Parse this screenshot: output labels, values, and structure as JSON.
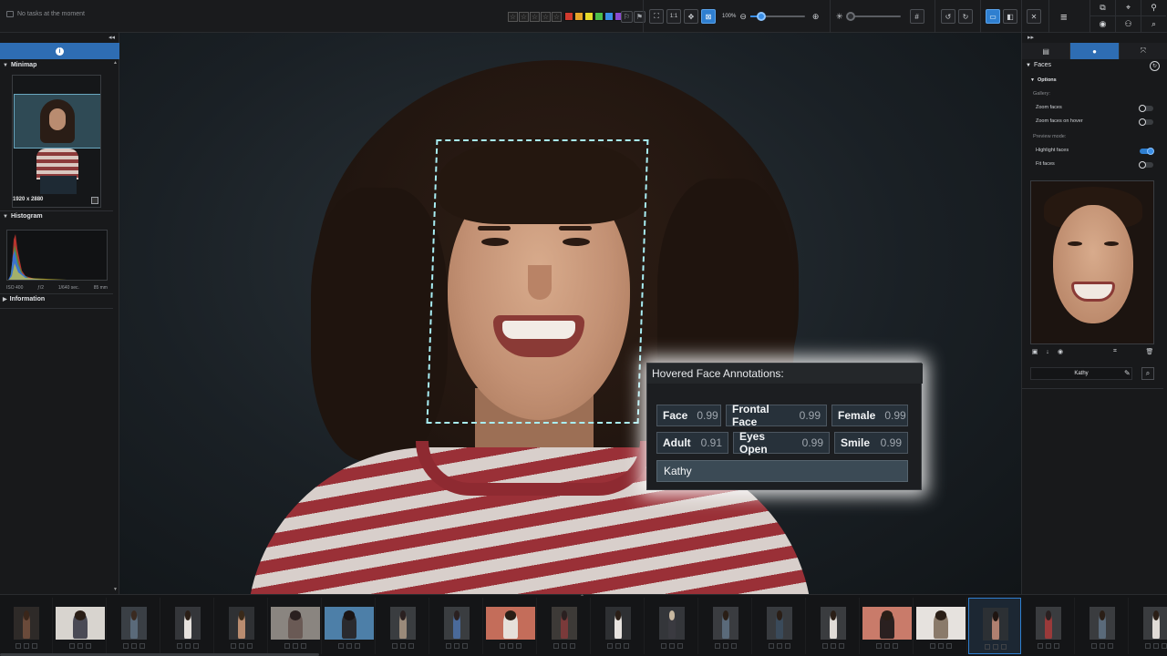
{
  "status": {
    "text": "No tasks at the moment"
  },
  "toolbar": {
    "stars": [
      "☆",
      "☆",
      "☆",
      "☆",
      "☆"
    ],
    "color_labels": [
      "#d03a2e",
      "#e6a52a",
      "#e6d92a",
      "#4cbf4a",
      "#3a8ee6",
      "#8a4ad0"
    ],
    "zoom_label": "1:1",
    "zoom_percent": "100%",
    "zoom_level": 0.2,
    "exposure_level": 0.0
  },
  "left_panel": {
    "minimap": {
      "title": "Minimap",
      "size": "1920 x 2880"
    },
    "histogram": {
      "title": "Histogram",
      "iso": "ISO 400",
      "aperture": "ƒ/2",
      "shutter": "1/640 sec.",
      "focal": "85 mm"
    },
    "information": {
      "title": "Information"
    }
  },
  "annotations": {
    "title": "Hovered Face Annotations:",
    "row1": [
      {
        "label": "Face",
        "score": "0.99"
      },
      {
        "label": "Frontal Face",
        "score": "0.99"
      },
      {
        "label": "Female",
        "score": "0.99"
      }
    ],
    "row2": [
      {
        "label": "Adult",
        "score": "0.91"
      },
      {
        "label": "Eyes Open",
        "score": "0.99"
      },
      {
        "label": "Smile",
        "score": "0.99"
      }
    ],
    "name": "Kathy"
  },
  "right_panel": {
    "faces_title": "Faces",
    "options_title": "Options",
    "gallery_label": "Gallery:",
    "zoom_faces": "Zoom faces",
    "zoom_faces_hover": "Zoom faces on hover",
    "preview_label": "Preview mode:",
    "highlight_faces": "Highlight faces",
    "fit_faces": "Fit faces",
    "toggles": {
      "zoom_faces": false,
      "zoom_faces_hover": false,
      "highlight_faces": true,
      "fit_faces": false
    },
    "person_name": "Kathy"
  },
  "filmstrip": {
    "thumbs": [
      {
        "bg": "#2e2a28",
        "person": "#6a4a3a",
        "head": "#3a261a"
      },
      {
        "bg": "#d8d4cf",
        "person": "#4a4a55",
        "head": "#2a1e16"
      },
      {
        "bg": "#3a3f45",
        "person": "#5a6a7a",
        "head": "#3a2a20"
      },
      {
        "bg": "#34363a",
        "person": "#e6e2de",
        "head": "#2a1e16"
      },
      {
        "bg": "#2f3134",
        "person": "#b98c70",
        "head": "#3a2a1a"
      },
      {
        "bg": "#8a8580",
        "person": "#6a5a55",
        "head": "#2a2020"
      },
      {
        "bg": "#4d7fa8",
        "person": "#2a2a2e",
        "head": "#1a1414"
      },
      {
        "bg": "#3a3d40",
        "person": "#9a8a7a",
        "head": "#2a2020"
      },
      {
        "bg": "#3a3d40",
        "person": "#4a6a9a",
        "head": "#2a2020"
      },
      {
        "bg": "#c46d5a",
        "person": "#e6e0da",
        "head": "#2a1e16"
      },
      {
        "bg": "#3d3a37",
        "person": "#7a3a3a",
        "head": "#2a2020"
      },
      {
        "bg": "#2e3033",
        "person": "#e8e4e0",
        "head": "#2a1e16"
      },
      {
        "bg": "#34363a",
        "person": "#3a3a40",
        "head": "#c8b8a0"
      },
      {
        "bg": "#3a3c40",
        "person": "#5a6a7a",
        "head": "#2a1e16"
      },
      {
        "bg": "#383b3f",
        "person": "#3a4a5a",
        "head": "#2a1e16"
      },
      {
        "bg": "#3a3c3f",
        "person": "#e0dcd8",
        "head": "#2a1e16"
      },
      {
        "bg": "#c97b6a",
        "person": "#2a2020",
        "head": "#2a1e16"
      },
      {
        "bg": "#e6e2de",
        "person": "#8a7a6a",
        "head": "#2a1e16"
      },
      {
        "bg": "#2c3034",
        "person": "#b08070",
        "head": "#1e1410"
      },
      {
        "bg": "#3a3c3f",
        "person": "#9a3a3a",
        "head": "#2a2020"
      },
      {
        "bg": "#3a3c3f",
        "person": "#5a6a7a",
        "head": "#2a1e16"
      },
      {
        "bg": "#3a3c3f",
        "person": "#e0dcd8",
        "head": "#2a1e16"
      }
    ],
    "selected_index": 18
  }
}
